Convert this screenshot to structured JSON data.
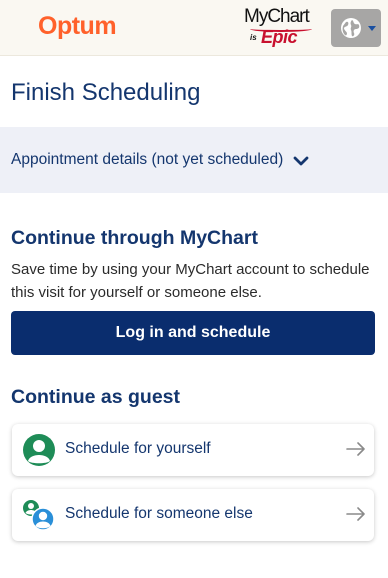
{
  "header": {
    "brand_logo": "Optum",
    "partner_logo": {
      "line1": "MyChart",
      "is": "is",
      "line2": "Epic"
    },
    "language_button": {
      "icon": "globe-icon",
      "caret": "caret-down-icon"
    }
  },
  "page_title": "Finish Scheduling",
  "details": {
    "label": "Appointment details (not yet scheduled)",
    "icon": "chevron-down-icon"
  },
  "mychart_section": {
    "heading": "Continue through MyChart",
    "description": "Save time by using your MyChart account to schedule this visit for yourself or someone else.",
    "button_label": "Log in and schedule"
  },
  "guest_section": {
    "heading": "Continue as guest",
    "options": [
      {
        "label": "Schedule for yourself",
        "icon": "person-icon",
        "arrow": "arrow-right-icon"
      },
      {
        "label": "Schedule for someone else",
        "icon": "people-icon",
        "arrow": "arrow-right-icon"
      }
    ]
  },
  "colors": {
    "brand_orange": "#ff612b",
    "navy": "#14366e",
    "button_navy": "#0a2d6e",
    "band": "#eef0f7",
    "icon_green": "#1e8c57",
    "icon_blue": "#2a8fd8",
    "epic_red": "#c8102e"
  }
}
